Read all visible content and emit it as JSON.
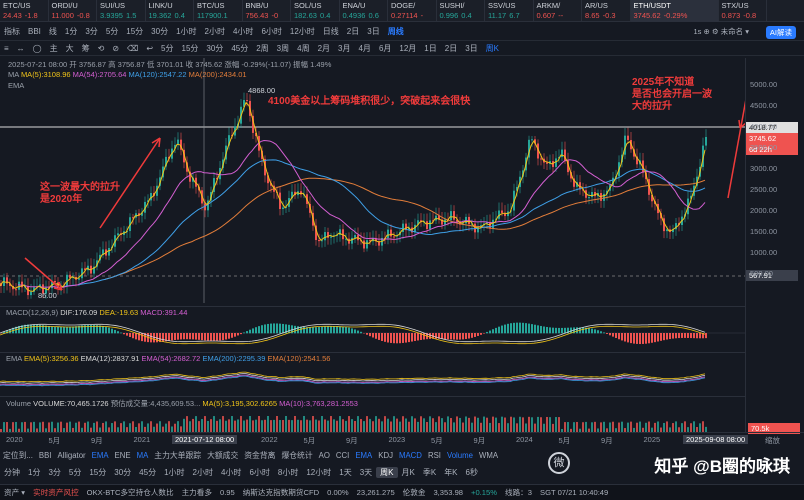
{
  "tickers": [
    {
      "name": "ETC/US",
      "price": "24.43",
      "chg": "-1.8",
      "dir": "dn"
    },
    {
      "name": "ORDI/U",
      "price": "11.000",
      "chg": "-0.8",
      "dir": "dn"
    },
    {
      "name": "SUI/US",
      "price": "3.9395",
      "chg": "1.5",
      "dir": "up"
    },
    {
      "name": "LINK/U",
      "price": "19.362",
      "chg": "0.4",
      "dir": "up"
    },
    {
      "name": "BTC/US",
      "price": "117900.1",
      "chg": "",
      "dir": "up"
    },
    {
      "name": "BNB/U",
      "price": "756.43",
      "chg": "-0",
      "dir": "dn"
    },
    {
      "name": "SOL/US",
      "price": "182.63",
      "chg": "0.4",
      "dir": "up"
    },
    {
      "name": "ENA/U",
      "price": "0.4936",
      "chg": "0.6",
      "dir": "up"
    },
    {
      "name": "DOGE/",
      "price": "0.27114",
      "chg": "-",
      "dir": "dn"
    },
    {
      "name": "SUSHI/",
      "price": "0.996",
      "chg": "0.4",
      "dir": "up"
    },
    {
      "name": "SSV/US",
      "price": "11.17",
      "chg": "6.7",
      "dir": "up"
    },
    {
      "name": "ARKM/",
      "price": "0.607",
      "chg": "--",
      "dir": "dn"
    },
    {
      "name": "AR/US",
      "price": "8.65",
      "chg": "-0.3",
      "dir": "dn"
    },
    {
      "name": "ETH/USDT",
      "price": "3745.62",
      "chg": "-0.29%",
      "dir": "dn",
      "active": true
    },
    {
      "name": "STX/US",
      "price": "0.873",
      "chg": "-0.8",
      "dir": "dn"
    }
  ],
  "toolbar": {
    "items": [
      "指标",
      "BBI",
      "线",
      "1分",
      "3分",
      "5分",
      "15分",
      "30分",
      "1小时",
      "2小时",
      "4小时",
      "6小时",
      "12小时",
      "日线",
      "2日",
      "3日",
      "周线"
    ],
    "active": "周线",
    "right": "1s  ⊕  ⚙  未命名 ▾",
    "ai": "AI解读"
  },
  "toolbar2": {
    "items": [
      "≡",
      "↔",
      "◯",
      "主",
      "大",
      "筹",
      "⟲",
      "⊘",
      "⌫",
      "↩",
      "5分",
      "15分",
      "30分",
      "45分",
      "2周",
      "3周",
      "4周",
      "2月",
      "3月",
      "4月",
      "6月",
      "12月",
      "1日",
      "2日",
      "3日",
      "周K"
    ],
    "active": "周K"
  },
  "info": {
    "line1": "2025-07-21 08:00  开 3756.87  高 3756.87  低 3701.01  收 3745.62  涨幅 -0.29%(-11.07)  振幅 1.49%",
    "ma_label": "MA",
    "ma5": "MA(5):3108.96",
    "ma54": "MA(54):2705.64",
    "ma120": "MA(120):2547.22",
    "ma200": "MA(200):2434.01",
    "ema_label": "EMA"
  },
  "annotations": {
    "a1": "4100美金以上筹码堆积很少，突破起来会很快",
    "a2": "这一波最大的拉升\n是2020年",
    "a3": "2025年不知道\n是否也会开启一波\n大的拉升"
  },
  "chart_labels": {
    "high": "4868.00",
    "low": "86.00"
  },
  "price_axis": {
    "ticks": [
      "5000.00",
      "4500.00",
      "4000.00",
      "3500.00",
      "3000.00",
      "2500.00",
      "2000.00",
      "1500.00",
      "1000.00",
      "500.00"
    ],
    "hline": "4018.77",
    "last": "3745.62",
    "countdown": "6d 22h",
    "low_tag": "567.91"
  },
  "macd": {
    "label": "MACD(12,26,9)",
    "dif": "DIF:176.09",
    "dea": "DEA:-19.63",
    "macd": "MACD:391.44"
  },
  "ema": {
    "label": "EMA",
    "e5": "EMA(5):3256.36",
    "e12": "EMA(12):2837.91",
    "e54": "EMA(54):2682.72",
    "e200": "EMA(200):2295.39",
    "e_x": "EMA(120):2541.56"
  },
  "volume": {
    "label": "Volume",
    "v": "VOLUME:70,465.1726",
    "est": "预估成交量:4,435,609.53...",
    "ma5": "MA(5):3,195,302.6265",
    "ma10": "MA(10):3,763,281.2553",
    "tag": "70.5k"
  },
  "x_axis": {
    "labels": [
      "2020",
      "5月",
      "9月",
      "2021",
      "5月",
      "9月",
      "2022",
      "5月",
      "9月",
      "2023",
      "5月",
      "9月",
      "2024",
      "5月",
      "9月",
      "2025",
      "5月"
    ],
    "cursor": "2021-07-12 08:00",
    "end": "2025-09-08 08:00",
    "zoom": "缩放"
  },
  "indicators": {
    "items": [
      "定位到...",
      "BBI",
      "Alligator",
      "EMA",
      "ENE",
      "MA",
      "主力大单跟踪",
      "大额成交",
      "资金背离",
      "爆仓统计",
      "AO",
      "CCI",
      "EMA",
      "KDJ",
      "MACD",
      "RSI",
      "Volume",
      "WMA"
    ],
    "blue": [
      "EMA",
      "MA",
      "MACD",
      "Volume"
    ]
  },
  "timeframes": {
    "items": [
      "分钟",
      "1分",
      "3分",
      "5分",
      "15分",
      "30分",
      "45分",
      "1小时",
      "2小时",
      "4小时",
      "6小时",
      "8小时",
      "12小时",
      "1天",
      "3天",
      "周K",
      "月K",
      "季K",
      "年K",
      "6秒"
    ],
    "active": "周K"
  },
  "status": {
    "items": [
      "资产 ▾",
      "实时资产风控",
      "OKX-BTC多空持仓人数比",
      "主力看多",
      "0.95",
      "纳斯达克指数期货CFD",
      "0.00%",
      "23,261.275",
      "伦敦金",
      "3,353.98",
      "+0.15%",
      "线路：3",
      "SGT 07/21 10:40:49"
    ]
  },
  "watermark": {
    "text": "知乎 @B圈的咏琪",
    "icon": "微"
  },
  "colors": {
    "up": "#26a69a",
    "down": "#ef5350",
    "ma5": "#f0c419",
    "ma54": "#d45fd2",
    "ma120": "#3fa0e8",
    "ma200": "#e27d3a",
    "accent": "#2a7bff"
  }
}
